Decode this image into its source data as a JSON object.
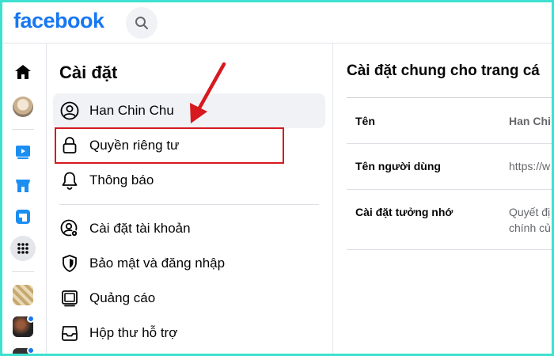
{
  "header": {
    "logo": "facebook",
    "search_icon": "search-icon"
  },
  "rail": {
    "items": [
      "home-icon",
      "profile-avatar",
      "watch-icon",
      "marketplace-icon",
      "gaming-icon",
      "menu-grid-icon",
      "shortcut-avatar-1",
      "shortcut-avatar-2",
      "shortcut-avatar-3"
    ]
  },
  "settings": {
    "title": "Cài đặt",
    "group1": [
      {
        "label": "Han Chin Chu",
        "icon": "user-circle-icon"
      },
      {
        "label": "Quyền riêng tư",
        "icon": "lock-icon"
      },
      {
        "label": "Thông báo",
        "icon": "bell-icon"
      }
    ],
    "group2": [
      {
        "label": "Cài đặt tài khoản",
        "icon": "account-settings-icon"
      },
      {
        "label": "Bảo mật và đăng nhập",
        "icon": "shield-icon"
      },
      {
        "label": "Quảng cáo",
        "icon": "ads-icon"
      },
      {
        "label": "Hộp thư hỗ trợ",
        "icon": "inbox-icon"
      }
    ]
  },
  "main": {
    "title": "Cài đặt chung cho trang cá",
    "rows": [
      {
        "label": "Tên",
        "value": "Han Chi"
      },
      {
        "label": "Tên người dùng",
        "value": "https://w"
      },
      {
        "label": "Cài đặt tưởng nhớ",
        "value_line1": "Quyết đị",
        "value_line2": "chính củ"
      }
    ]
  },
  "colors": {
    "brand": "#1877f2",
    "highlight": "#d7191f",
    "frame": "#3ee0cf"
  }
}
